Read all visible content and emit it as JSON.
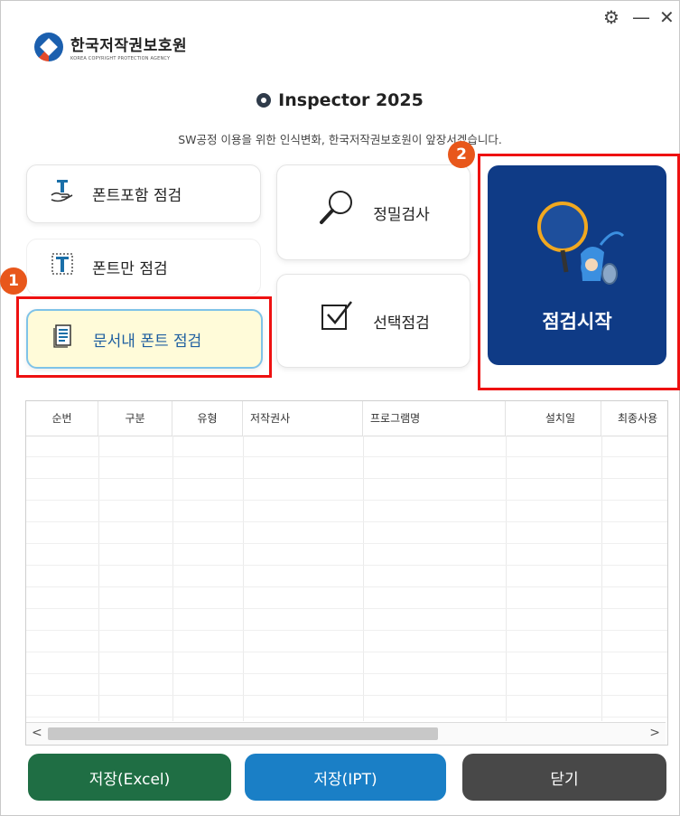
{
  "window": {
    "settings_icon": "gear-icon",
    "minimize_label": "—",
    "close_label": "✕"
  },
  "logo": {
    "kr": "한국저작권보호원",
    "en": "KOREA COPYRIGHT PROTECTION AGENCY"
  },
  "header": {
    "title": "Inspector 2025",
    "subtitle": "SW공정 이용을 위한 인식변화, 한국저작권보호원이 앞장서겠습니다."
  },
  "options": {
    "font_include": "폰트포함 점검",
    "font_only": "폰트만 점검",
    "doc_font": "문서내 폰트 점검",
    "detail": "정밀검사",
    "selective": "선택점검",
    "start": "점검시작"
  },
  "badges": {
    "one": "1",
    "two": "2"
  },
  "table": {
    "columns": [
      "순번",
      "구분",
      "유형",
      "저작권사",
      "프로그램명",
      "설치일",
      "최종사용"
    ]
  },
  "scrollbar": {
    "left": "<",
    "right": ">"
  },
  "buttons": {
    "excel": "저장(Excel)",
    "ipt": "저장(IPT)",
    "close": "닫기"
  },
  "colors": {
    "accent": "#0f3b86",
    "excel": "#1f6e44",
    "ipt": "#1a7fc6",
    "close": "#484848",
    "highlight": "#e11111",
    "badge": "#e8571b"
  }
}
